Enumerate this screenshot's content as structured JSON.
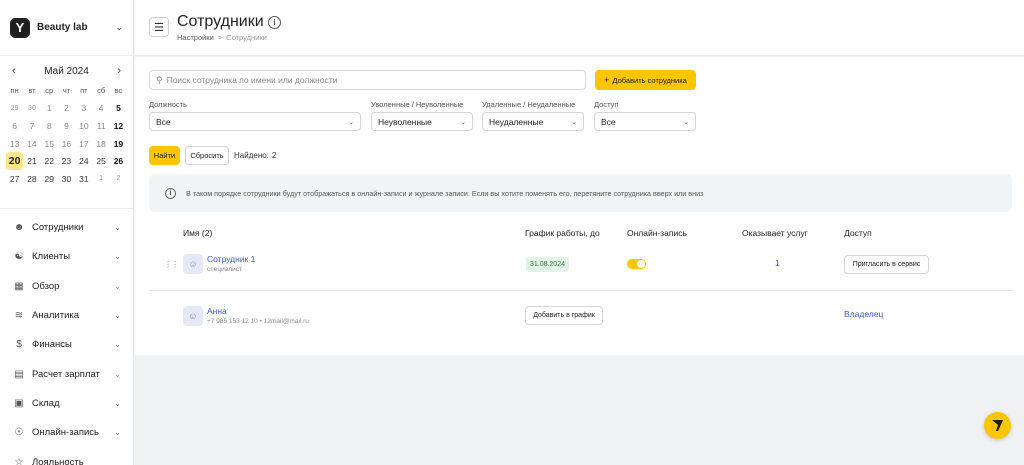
{
  "sidebar": {
    "brand": "Beauty lab",
    "logo_letter": "Y",
    "calendar": {
      "month_label": "Май 2024",
      "weekdays": [
        "пн",
        "вт",
        "ср",
        "чт",
        "пт",
        "сб",
        "вс"
      ],
      "weeks": [
        [
          "29",
          "30",
          "1",
          "2",
          "3",
          "4",
          "5"
        ],
        [
          "6",
          "7",
          "8",
          "9",
          "10",
          "11",
          "12"
        ],
        [
          "13",
          "14",
          "15",
          "16",
          "17",
          "18",
          "19"
        ],
        [
          "20",
          "21",
          "22",
          "23",
          "24",
          "25",
          "26"
        ],
        [
          "27",
          "28",
          "29",
          "30",
          "31",
          "1",
          "2"
        ]
      ],
      "selected_day": "20"
    },
    "items": [
      {
        "label": "Сотрудники",
        "icon": "user-icon"
      },
      {
        "label": "Клиенты",
        "icon": "users-icon"
      },
      {
        "label": "Обзор",
        "icon": "grid-icon"
      },
      {
        "label": "Аналитика",
        "icon": "chart-icon"
      },
      {
        "label": "Финансы",
        "icon": "dollar-icon"
      },
      {
        "label": "Расчет зарплат",
        "icon": "payroll-icon"
      },
      {
        "label": "Склад",
        "icon": "boxes-icon"
      },
      {
        "label": "Онлайн-запись",
        "icon": "globe-icon"
      },
      {
        "label": "Лояльность",
        "icon": "loyalty-icon"
      }
    ]
  },
  "header": {
    "title": "Сотрудники",
    "breadcrumb_parent": "Настройки",
    "breadcrumb_separator": ">",
    "breadcrumb_current": "Сотрудники"
  },
  "toolbar": {
    "search_placeholder": "Поиск сотрудника по имени или должности",
    "add_label": "Добавить сотрудника"
  },
  "filters": {
    "position_label": "Должность",
    "position_value": "Все",
    "fired_label": "Уволенные / Неуволенные",
    "fired_value": "Неуволенные",
    "deleted_label": "Удаленные / Неудаленные",
    "deleted_value": "Неудаленные",
    "access_label": "Доступ",
    "access_value": "Все",
    "find_label": "Найти",
    "reset_label": "Сбросить",
    "found_label": "Найдено:",
    "found_count": "2"
  },
  "notice": "В таком порядке сотрудники будут отображаться в онлайн-записи и журнале записи. Если вы хотите поменять его, перетяните сотрудника вверх или вниз",
  "table": {
    "headers": {
      "name": "Имя (2)",
      "schedule": "График работы, до",
      "online": "Онлайн-запись",
      "services": "Оказывает услуг",
      "access": "Доступ"
    },
    "rows": [
      {
        "name": "Сотрудник 1",
        "role": "специалист",
        "schedule_until": "31.08.2024",
        "online_enabled": true,
        "services_count": "1",
        "access_action": "Пригласить в сервис"
      },
      {
        "name": "Анна",
        "contact": "+7 985 153 12 10 • 12mail@mail.ru",
        "schedule_action": "Добавить в график",
        "access_status": "Владелец"
      }
    ]
  },
  "colors": {
    "accent": "#fbc600",
    "link": "#3b5bb5",
    "badge_bg": "#e3f4e6"
  }
}
